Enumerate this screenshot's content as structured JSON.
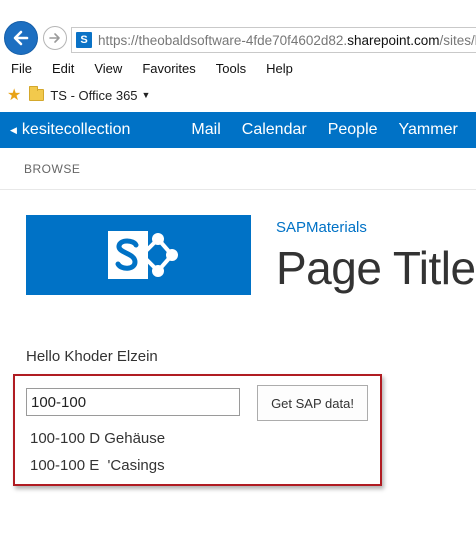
{
  "browser": {
    "url_prefix": "https://theobaldsoftware-4fde70f4602d82.",
    "url_domain": "sharepoint.com",
    "url_suffix": "/sites/kesitecollection",
    "favicon_letter": "S",
    "menu": [
      "File",
      "Edit",
      "View",
      "Favorites",
      "Tools",
      "Help"
    ],
    "favorites_folder": "TS - Office 365"
  },
  "suite_bar": {
    "site_link": "kesitecollection",
    "nav": [
      "Mail",
      "Calendar",
      "People",
      "Yammer"
    ],
    "color": "#0072c6"
  },
  "ribbon": {
    "tab": "BROWSE"
  },
  "site": {
    "name": "SAPMaterials",
    "page_title": "Page Title"
  },
  "content": {
    "greeting": "Hello Khoder Elzein",
    "input_value": "100-100",
    "button_label": "Get SAP data!",
    "results": [
      "100-100 D Gehäuse",
      "100-100 E  'Casings"
    ]
  }
}
